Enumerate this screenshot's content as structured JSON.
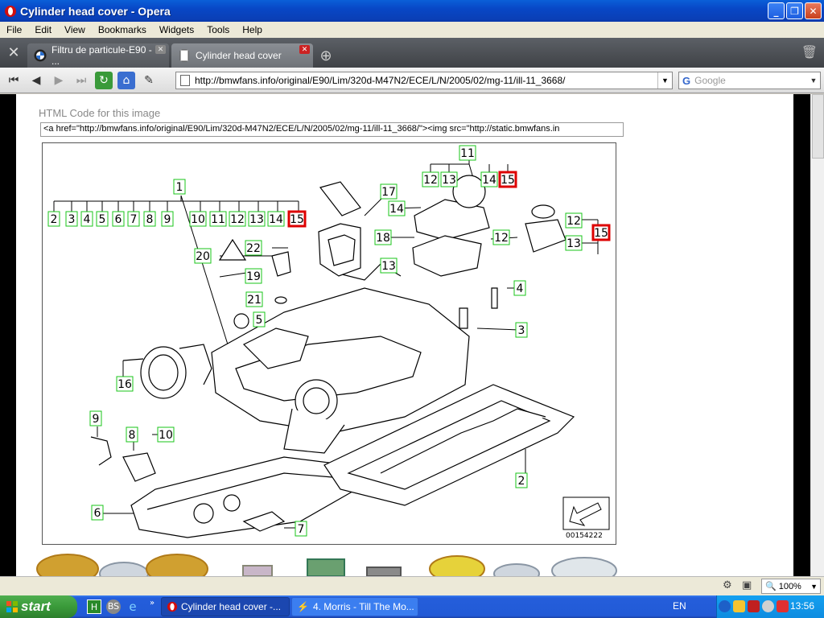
{
  "window": {
    "title": "Cylinder head cover - Opera"
  },
  "menu": [
    "File",
    "Edit",
    "View",
    "Bookmarks",
    "Widgets",
    "Tools",
    "Help"
  ],
  "tabs": [
    {
      "label": "Filtru de particule-E90 - ...",
      "active": false
    },
    {
      "label": "Cylinder head cover",
      "active": true
    }
  ],
  "address": {
    "url": "http://bmwfans.info/original/E90/Lim/320d-M47N2/ECE/L/N/2005/02/mg-11/ill-11_3668/"
  },
  "search": {
    "engine": "G",
    "placeholder": "Google"
  },
  "page": {
    "html_code_label": "HTML Code for this image",
    "html_code_value": "<a href=\"http://bmwfans.info/original/E90/Lim/320d-M47N2/ECE/L/N/2005/02/mg-11/ill-11_3668/\"><img src=\"http://static.bmwfans.in",
    "diagram_code": "00154222",
    "part_labels": {
      "row_top": [
        "2",
        "3",
        "4",
        "5",
        "6",
        "7",
        "8",
        "9",
        "10",
        "11",
        "12",
        "13",
        "14",
        "15"
      ],
      "group_top": "1",
      "group_tr_top": "11",
      "row_tr": [
        "12",
        "13",
        "14",
        "15"
      ],
      "far_right": [
        "12",
        "13",
        "15"
      ],
      "misc": [
        "17",
        "14",
        "18",
        "12",
        "13",
        "22",
        "20",
        "19",
        "21",
        "5",
        "4",
        "3",
        "16",
        "9",
        "8",
        "10",
        "6",
        "7",
        "2"
      ]
    }
  },
  "status": {
    "zoom": "100%"
  },
  "taskbar": {
    "start_label": "start",
    "items": [
      {
        "label": "Cylinder head cover -...",
        "active": true
      },
      {
        "label": "4. Morris - Till The Mo...",
        "active": false
      }
    ],
    "language": "EN",
    "clock": "13:56"
  }
}
